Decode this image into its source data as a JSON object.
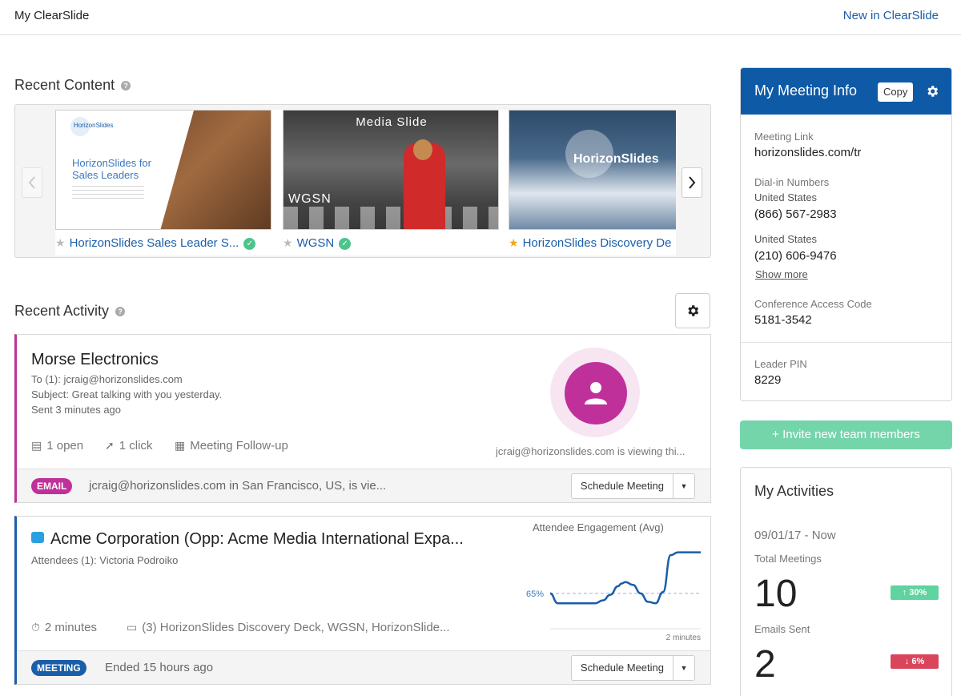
{
  "topbar": {
    "title": "My ClearSlide",
    "new_link": "New in ClearSlide"
  },
  "recent_content": {
    "heading": "Recent Content",
    "items": [
      {
        "title": "HorizonSlides Sales Leader S...",
        "starred": false,
        "verified": true,
        "thumb_logo": "HorizonSlides",
        "thumb_headline": "HorizonSlides for Sales Leaders"
      },
      {
        "title": "WGSN",
        "starred": false,
        "verified": true,
        "thumb_label": "Media Slide",
        "thumb_brand": "WGSN"
      },
      {
        "title": "HorizonSlides Discovery De",
        "starred": true,
        "verified": false,
        "thumb_brand": "HorizonSlides"
      }
    ]
  },
  "recent_activity": {
    "heading": "Recent Activity",
    "email": {
      "title": "Morse Electronics",
      "to": "To (1): jcraig@horizonslides.com",
      "subject": "Subject: Great talking with you yesterday.",
      "sent": "Sent 3 minutes ago",
      "opens": "1 open",
      "clicks": "1 click",
      "content": "Meeting Follow-up",
      "viewing": "jcraig@horizonslides.com is viewing thi...",
      "badge": "EMAIL",
      "footer_text": "jcraig@horizonslides.com in San Francisco, US, is vie...",
      "schedule_label": "Schedule Meeting"
    },
    "meeting": {
      "title": "Acme Corporation (Opp: Acme Media International Expa...",
      "attendees": "Attendees (1): Victoria Podroiko",
      "duration": "2 minutes",
      "decks": "(3)  HorizonSlides Discovery Deck, WGSN, HorizonSlide...",
      "badge": "MEETING",
      "footer_text": "Ended 15 hours ago",
      "schedule_label": "Schedule Meeting",
      "engagement_title": "Attendee Engagement (Avg)",
      "avg_label": "65%",
      "x_end_label": "2 minutes"
    }
  },
  "chart_data": {
    "type": "line",
    "title": "Attendee Engagement (Avg)",
    "x": [
      0,
      0.1,
      0.2,
      0.3,
      0.4,
      0.5,
      0.6,
      0.7,
      0.8,
      0.9,
      0.95,
      1.0,
      1.1,
      1.2,
      1.3,
      1.4,
      1.5,
      1.6,
      1.7,
      1.8,
      1.85,
      1.9,
      2.0
    ],
    "values": [
      65,
      58,
      58,
      58,
      58,
      58,
      58,
      60,
      64,
      70,
      72,
      73,
      71,
      65,
      59,
      58,
      66,
      92,
      94,
      94,
      94,
      94,
      94
    ],
    "reference_line": 65,
    "reference_label": "65%",
    "xlabel_end": "2 minutes",
    "ylim": [
      40,
      100
    ]
  },
  "meeting_info": {
    "title": "My Meeting Info",
    "copy_label": "Copy",
    "meeting_link_label": "Meeting Link",
    "meeting_link": "horizonslides.com/tr",
    "dial_in_label": "Dial-in Numbers",
    "country1": "United States",
    "phone1": "(866) 567-2983",
    "country2": "United States",
    "phone2": "(210) 606-9476",
    "show_more": "Show more",
    "access_code_label": "Conference Access Code",
    "access_code": "5181-3542",
    "leader_pin_label": "Leader PIN",
    "leader_pin": "8229"
  },
  "invite": {
    "label": "+ Invite new team members"
  },
  "my_activities": {
    "title": "My Activities",
    "range": "09/01/17 - Now",
    "total_meetings_label": "Total Meetings",
    "total_meetings": "10",
    "meetings_trend": "↑ 30%",
    "emails_sent_label": "Emails Sent",
    "emails_sent": "2",
    "emails_trend": "↓ 6%"
  },
  "colors": {
    "brand_blue": "#0e5aa7",
    "email_pink": "#c0309a",
    "invite_green": "#74d5ab",
    "trend_up": "#5fd3a0",
    "trend_down": "#d9455b",
    "verified_check": "#4cc48a"
  }
}
